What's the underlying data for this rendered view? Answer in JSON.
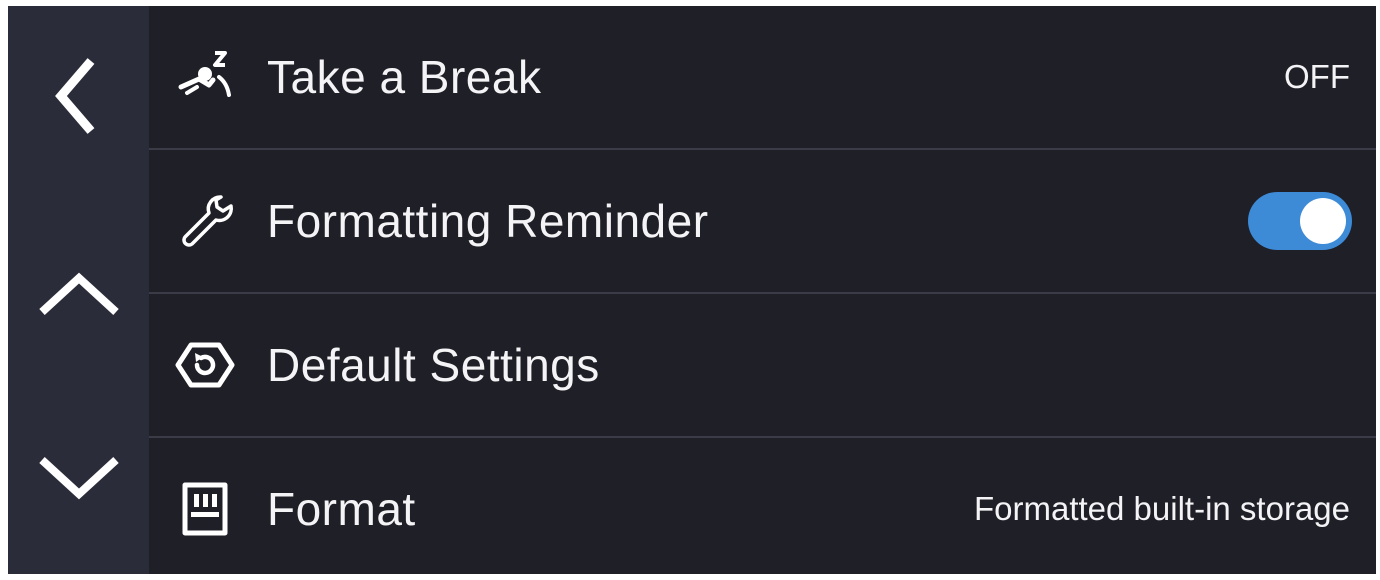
{
  "nav": {
    "back_icon": "chevron-left-icon",
    "up_icon": "chevron-up-icon",
    "down_icon": "chevron-down-icon"
  },
  "menu": {
    "items": [
      {
        "icon": "sleeping-person-icon",
        "label": "Take a Break",
        "value": "OFF"
      },
      {
        "icon": "wrench-icon",
        "label": "Formatting Reminder",
        "toggle_on": true
      },
      {
        "icon": "reset-hexagon-icon",
        "label": "Default Settings"
      },
      {
        "icon": "memory-card-icon",
        "label": "Format",
        "value": "Formatted built-in storage"
      }
    ]
  },
  "colors": {
    "background": "#1f1f27",
    "rail": "#2b2c39",
    "divider": "#3a3b47",
    "toggle_on": "#3d8ad6",
    "text": "#f4f4f6"
  }
}
